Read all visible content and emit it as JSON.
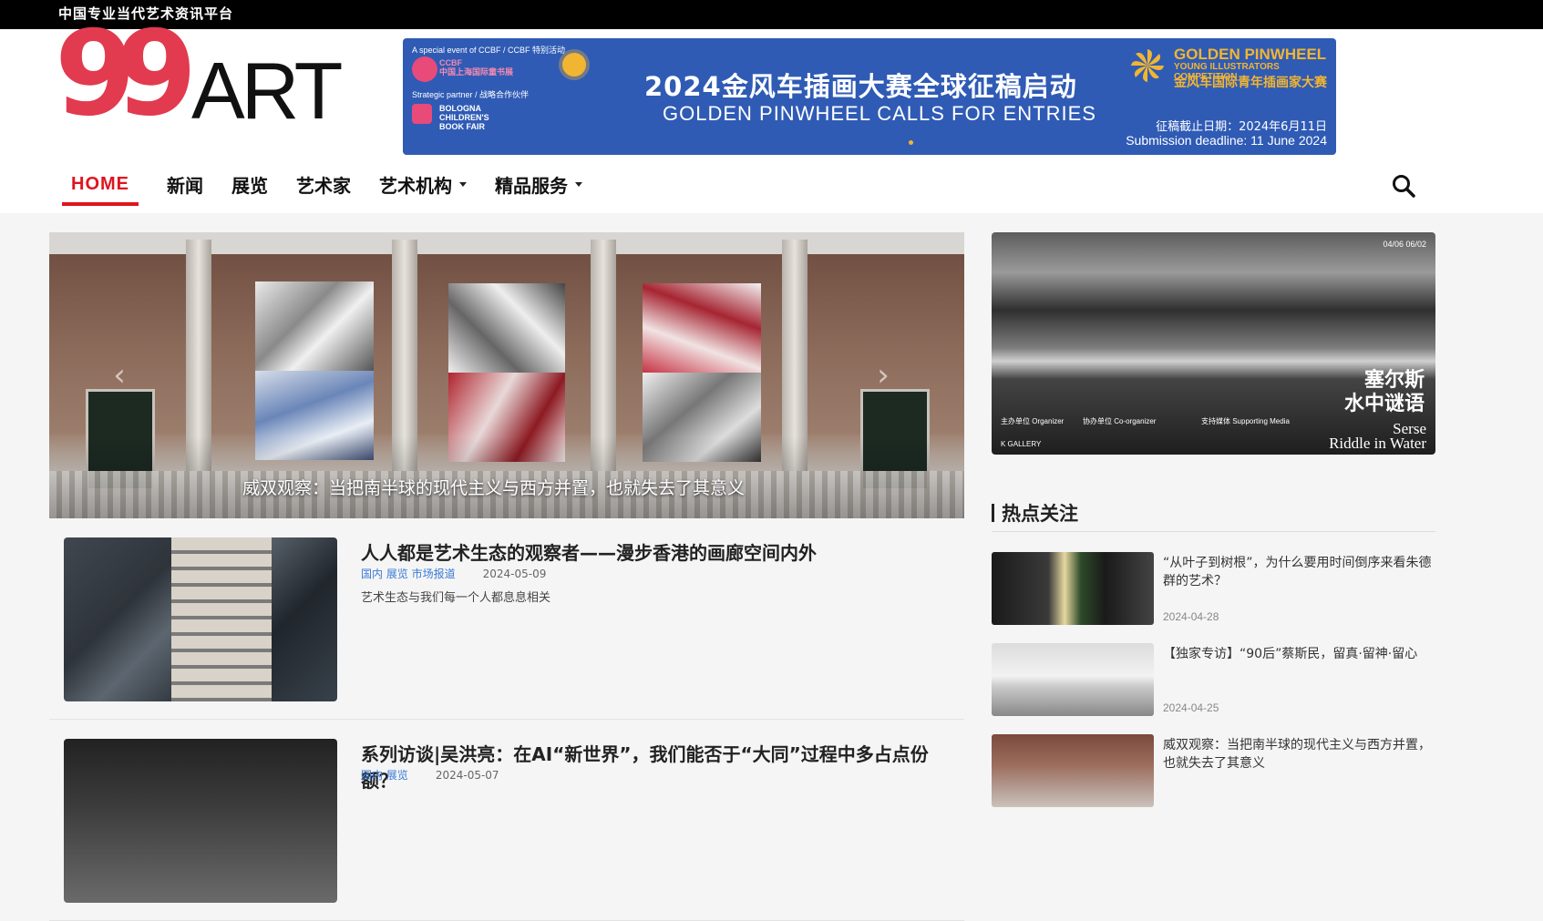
{
  "topbar": {
    "tagline": "中国专业当代艺术资讯平台"
  },
  "logo": {
    "numbers": "99",
    "word": "ART"
  },
  "banner": {
    "event_line": "A special event of CCBF / CCBF 特别活动",
    "ccbf_label": "CCBF",
    "ccbf_cn": "中国上海国际童书展",
    "partner_line": "Strategic partner / 战略合作伙伴",
    "bologna": "BOLOGNA CHILDREN'S BOOK FAIR",
    "title_cn": "2024金风车插画大赛全球征稿启动",
    "title_en": "GOLDEN PINWHEEL CALLS FOR ENTRIES",
    "brand_en": "GOLDEN PINWHEEL",
    "brand_en_sub": "YOUNG ILLUSTRATORS COMPETITION",
    "brand_cn": "金风车国际青年插画家大赛",
    "deadline_cn": "征稿截止日期：2024年6月11日",
    "deadline_en": "Submission deadline: 11 June 2024",
    "colors": {
      "bg": "#2f5bb5",
      "accent": "#f2b531"
    }
  },
  "nav": {
    "items": [
      {
        "label": "HOME",
        "active": true
      },
      {
        "label": "新闻"
      },
      {
        "label": "展览"
      },
      {
        "label": "艺术家"
      },
      {
        "label": "艺术机构",
        "dropdown": true
      },
      {
        "label": "精品服务",
        "dropdown": true
      }
    ],
    "search_icon": "search-icon",
    "accent": "#e0141e"
  },
  "slider": {
    "caption": "威双观察：当把南半球的现代主义与西方并置，也就失去了其意义",
    "prev": "‹",
    "next": "›"
  },
  "articles": [
    {
      "title": "人人都是艺术生态的观察者——漫步香港的画廊空间内外",
      "tags": "国内 展览 市场报道",
      "date": "2024-05-09",
      "excerpt": "艺术生态与我们每一个人都息息相关"
    },
    {
      "title": "系列访谈|吴洪亮：在AI“新世界”，我们能否于“大同”过程中多占点份额？",
      "tags": "国内 展览",
      "date": "2024-05-07",
      "excerpt": ""
    }
  ],
  "side_banner": {
    "date_range": "04/06    06/02",
    "title_cn_1": "塞尔斯",
    "title_cn_2": "水中谜语",
    "title_en_1": "Serse",
    "title_en_2": "Riddle in Water",
    "organizer": "主办单位 Organizer",
    "gallery": "K GALLERY",
    "co_organizer": "协办单位 Co-organizer",
    "media": "支持媒体 Supporting Media"
  },
  "hot": {
    "title": "热点关注",
    "items": [
      {
        "text": "“从叶子到树根”，为什么要用时间倒序来看朱德群的艺术？",
        "date": "2024-04-28"
      },
      {
        "text": "【独家专访】“90后”蔡斯民，留真·留神·留心",
        "date": "2024-04-25"
      },
      {
        "text": "威双观察：当把南半球的现代主义与西方并置，也就失去了其意义",
        "date": ""
      }
    ]
  }
}
